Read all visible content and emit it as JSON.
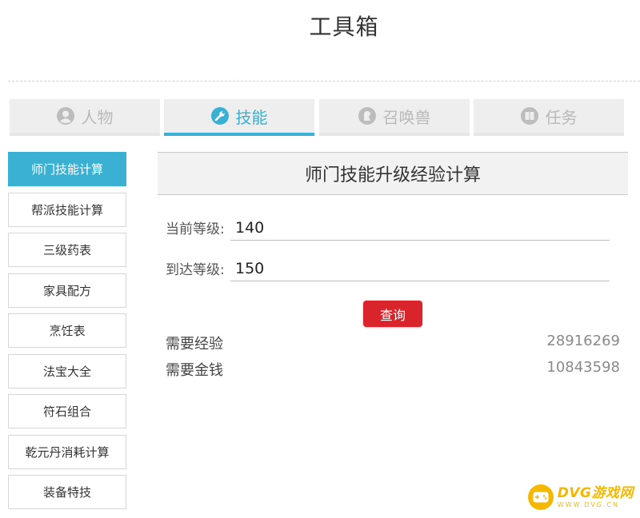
{
  "app": {
    "title": "工具箱"
  },
  "tabs": [
    {
      "label": "人物",
      "icon": "person-icon",
      "active": false
    },
    {
      "label": "技能",
      "icon": "wrench-icon",
      "active": true
    },
    {
      "label": "召唤兽",
      "icon": "pet-icon",
      "active": false
    },
    {
      "label": "任务",
      "icon": "book-icon",
      "active": false
    }
  ],
  "sidebar": {
    "items": [
      {
        "label": "师门技能计算",
        "active": true
      },
      {
        "label": "帮派技能计算",
        "active": false
      },
      {
        "label": "三级药表",
        "active": false
      },
      {
        "label": "家具配方",
        "active": false
      },
      {
        "label": "烹饪表",
        "active": false
      },
      {
        "label": "法宝大全",
        "active": false
      },
      {
        "label": "符石组合",
        "active": false
      },
      {
        "label": "乾元丹消耗计算",
        "active": false
      },
      {
        "label": "装备特技",
        "active": false
      }
    ]
  },
  "panel": {
    "title": "师门技能升级经验计算",
    "current_level": {
      "label": "当前等级:",
      "value": "140"
    },
    "target_level": {
      "label": "到达等级:",
      "value": "150"
    },
    "query_label": "查询",
    "results": [
      {
        "label": "需要经验",
        "value": "28916269"
      },
      {
        "label": "需要金钱",
        "value": "10843598"
      }
    ]
  },
  "watermark": {
    "name": "DVG游戏网",
    "url": "WWW.DVG.CN"
  },
  "colors": {
    "accent": "#3ab0d3",
    "button": "#d9242c",
    "inactive_tab_text": "#b9b9b9",
    "watermark": "#f5b800"
  }
}
